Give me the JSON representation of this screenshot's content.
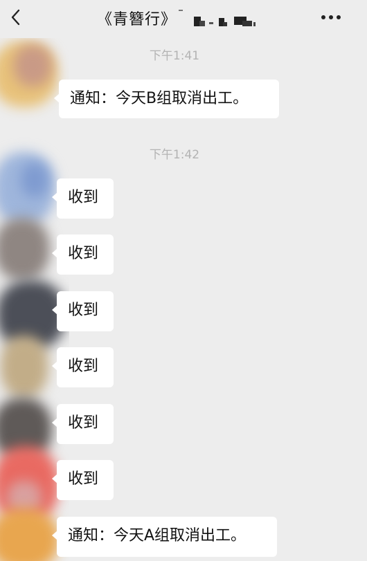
{
  "header": {
    "title": "《青簪行》",
    "back_icon": "chevron-left-icon",
    "more_icon": "ellipsis-icon"
  },
  "messages": [
    {
      "type": "time",
      "text": "下午1:41"
    },
    {
      "type": "text",
      "text": "通知：今天B组取消出工。"
    },
    {
      "type": "time",
      "text": "下午1:42"
    },
    {
      "type": "text",
      "text": "收到"
    },
    {
      "type": "text",
      "text": "收到"
    },
    {
      "type": "text",
      "text": "收到"
    },
    {
      "type": "text",
      "text": "收到"
    },
    {
      "type": "text",
      "text": "收到"
    },
    {
      "type": "text",
      "text": "收到"
    },
    {
      "type": "text",
      "text": "通知：今天A组取消出工。"
    }
  ]
}
